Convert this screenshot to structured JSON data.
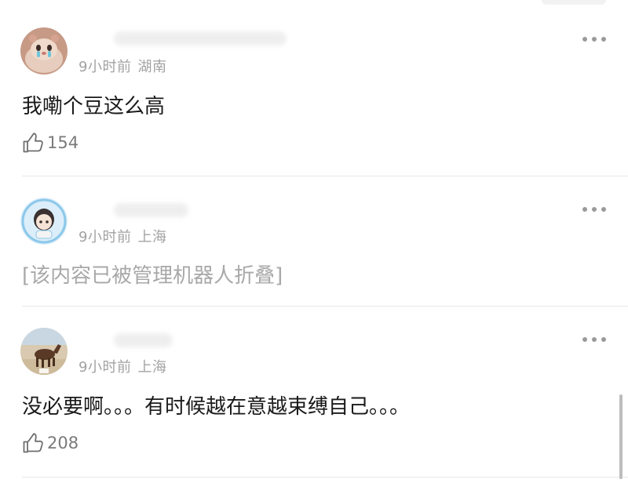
{
  "comments": [
    {
      "time": "9小时前",
      "region": "湖南",
      "content": "我嘞个豆这么高",
      "likes": "154",
      "avatar_icon": "hamster-avatar"
    },
    {
      "time": "9小时前",
      "region": "上海",
      "content": "[该内容已被管理机器人折叠]",
      "avatar_icon": "anime-girl-avatar"
    },
    {
      "time": "9小时前",
      "region": "上海",
      "content": "没必要啊。。。有时候越在意越束缚自己。。。",
      "likes": "208",
      "avatar_icon": "horse-avatar"
    }
  ],
  "icons": {
    "like": "thumbs-up-icon",
    "more": "more-dots-icon"
  },
  "colors": {
    "meta_text": "#a3a3a3",
    "content_text": "#1a1a1a",
    "folded_text": "#a8a8a8",
    "divider": "#e8e8e8"
  }
}
